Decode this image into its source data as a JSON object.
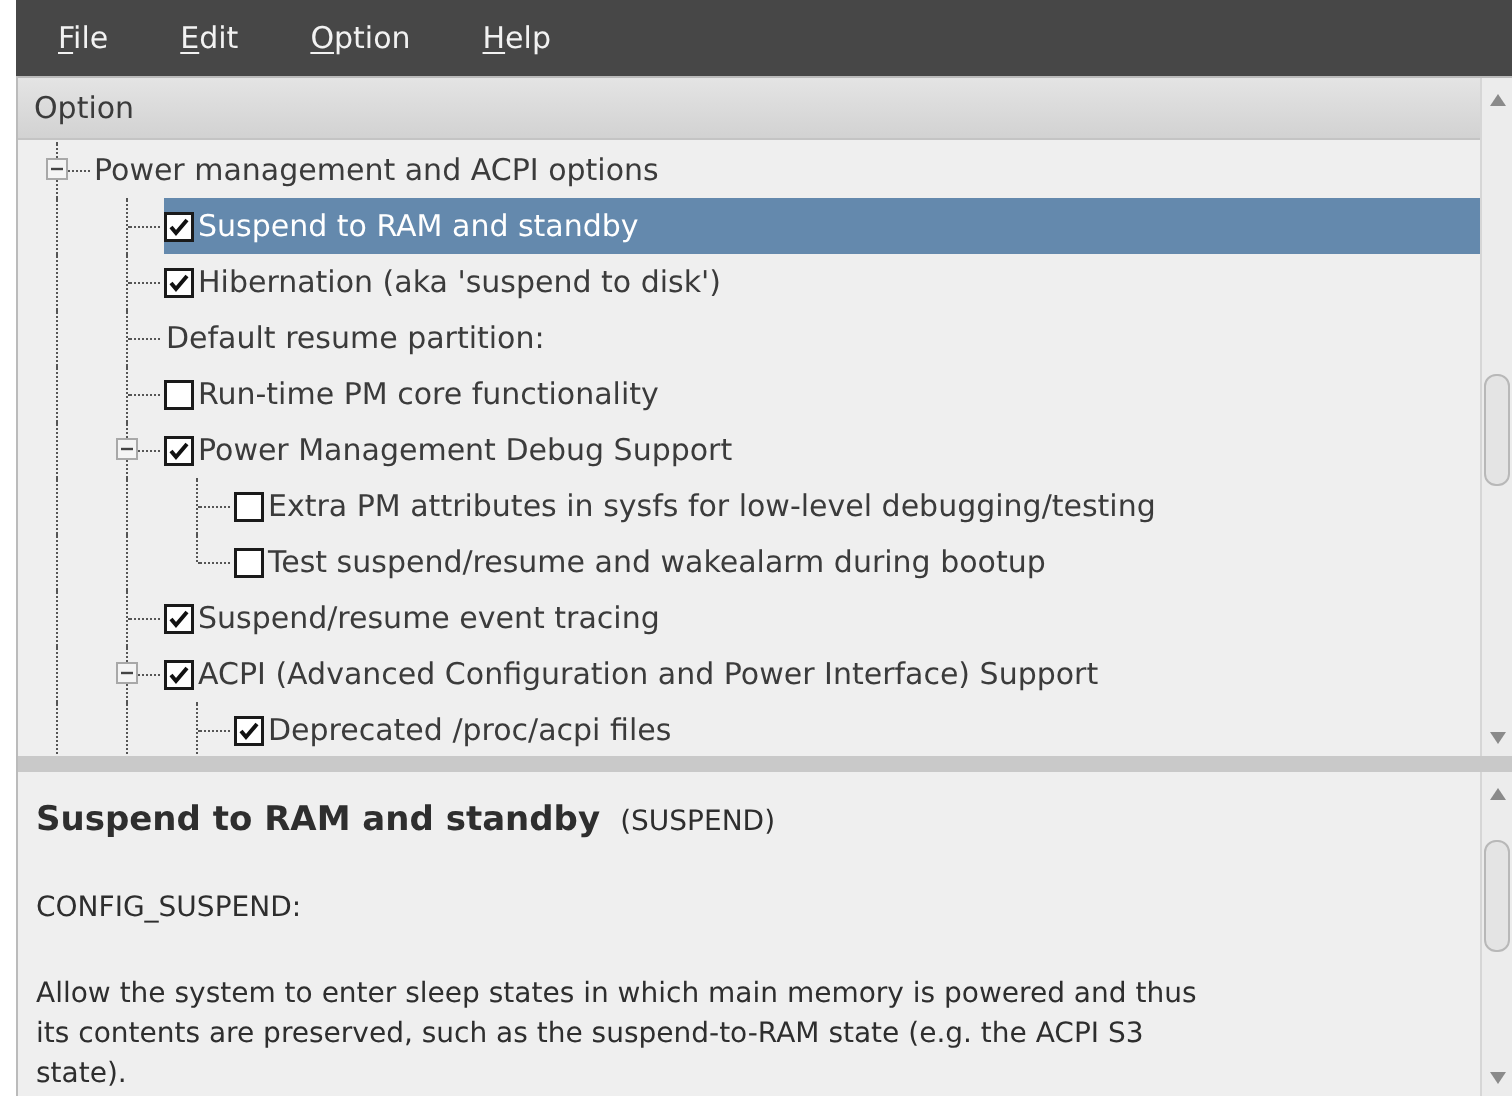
{
  "menu": [
    "File",
    "Edit",
    "Option",
    "Help"
  ],
  "tree": {
    "header": "Option",
    "items": [
      {
        "kind": "group",
        "label": "Power management and ACPI options",
        "expanded": true,
        "selected": false,
        "children": [
          {
            "kind": "checkbox",
            "label": "Suspend to RAM and standby",
            "checked": true,
            "selected": true
          },
          {
            "kind": "checkbox",
            "label": "Hibernation (aka 'suspend to disk')",
            "checked": true,
            "selected": false
          },
          {
            "kind": "label",
            "label": "Default resume partition:",
            "selected": false
          },
          {
            "kind": "checkbox",
            "label": "Run-time PM core functionality",
            "checked": false,
            "selected": false
          },
          {
            "kind": "checkbox",
            "label": "Power Management Debug Support",
            "checked": true,
            "selected": false,
            "expanded": true,
            "children": [
              {
                "kind": "checkbox",
                "label": "Extra PM attributes in sysfs for low-level debugging/testing",
                "checked": false,
                "selected": false
              },
              {
                "kind": "checkbox",
                "label": "Test suspend/resume and wakealarm during bootup",
                "checked": false,
                "selected": false
              }
            ]
          },
          {
            "kind": "checkbox",
            "label": "Suspend/resume event tracing",
            "checked": true,
            "selected": false
          },
          {
            "kind": "checkbox",
            "label": "ACPI (Advanced Configuration and Power Interface) Support",
            "checked": true,
            "selected": false,
            "expanded": true,
            "children": [
              {
                "kind": "checkbox",
                "label": "Deprecated /proc/acpi files",
                "checked": true,
                "selected": false
              }
            ]
          }
        ]
      }
    ]
  },
  "details": {
    "title": "Suspend to RAM and standby",
    "symbol": "(SUSPEND)",
    "config": "CONFIG_SUSPEND:",
    "description": "Allow the system to enter sleep states in which main memory is powered and thus its contents are preserved, such as the suspend-to-RAM state (e.g. the ACPI S3 state)."
  }
}
